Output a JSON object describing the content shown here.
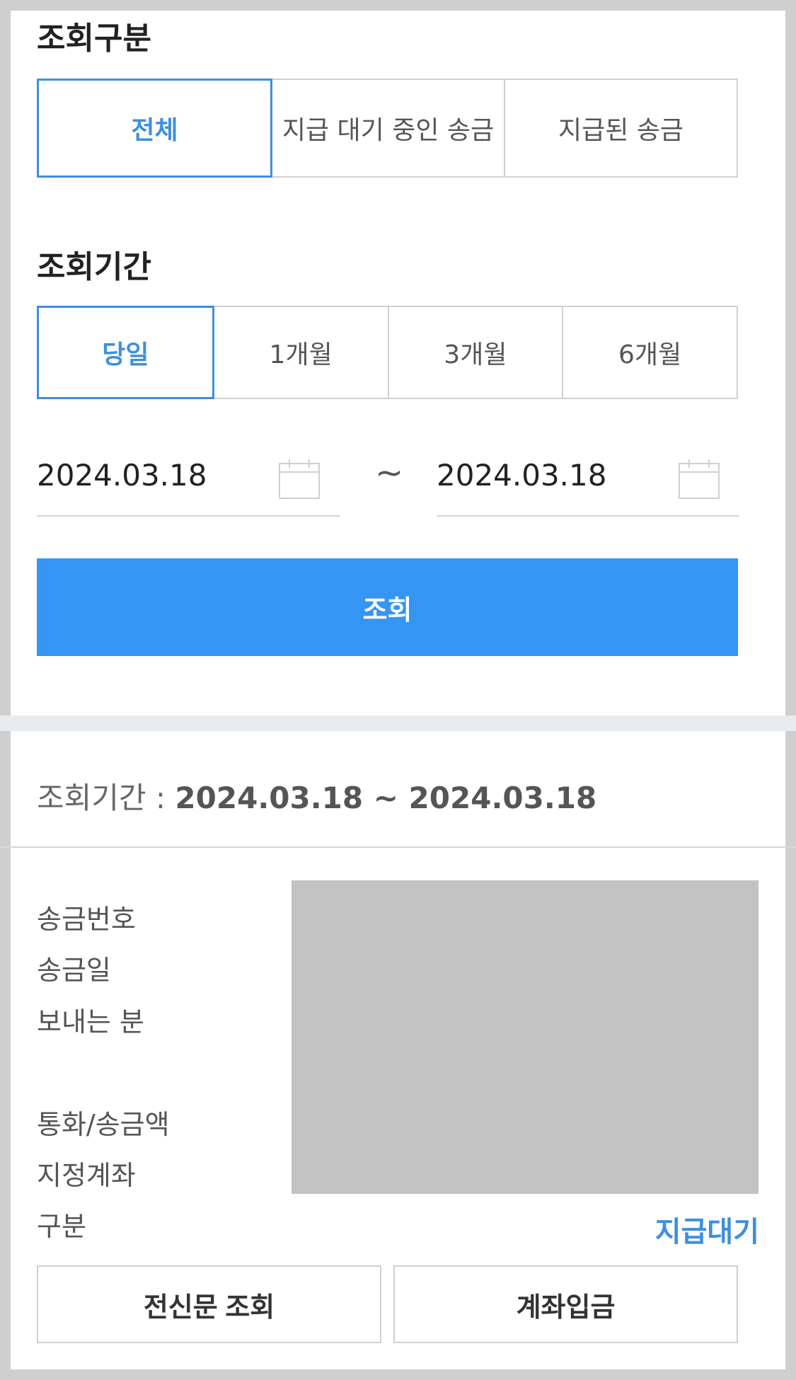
{
  "filter_type": {
    "title": "조회구분",
    "options": [
      "전체",
      "지급 대기 중인 송금",
      "지급된 송금"
    ],
    "selected": 0
  },
  "filter_period": {
    "title": "조회기간",
    "options": [
      "당일",
      "1개월",
      "3개월",
      "6개월"
    ],
    "selected": 0
  },
  "dates": {
    "start": "2024.03.18",
    "end": "2024.03.18",
    "separator": "~"
  },
  "query_button": "조회",
  "summary": {
    "label": "조회기간 : ",
    "range": "2024.03.18 ~ 2024.03.18"
  },
  "details": {
    "labels": [
      "송금번호",
      "송금일",
      "보내는 분",
      "통화/송금액",
      "지정계좌",
      "구분"
    ],
    "status": "지급대기"
  },
  "actions": {
    "telegram": "전신문 조회",
    "deposit": "계좌입금"
  },
  "colors": {
    "accent": "#3d8fe0",
    "primary_button": "#3495f4",
    "redacted": "#c2c2c2"
  }
}
